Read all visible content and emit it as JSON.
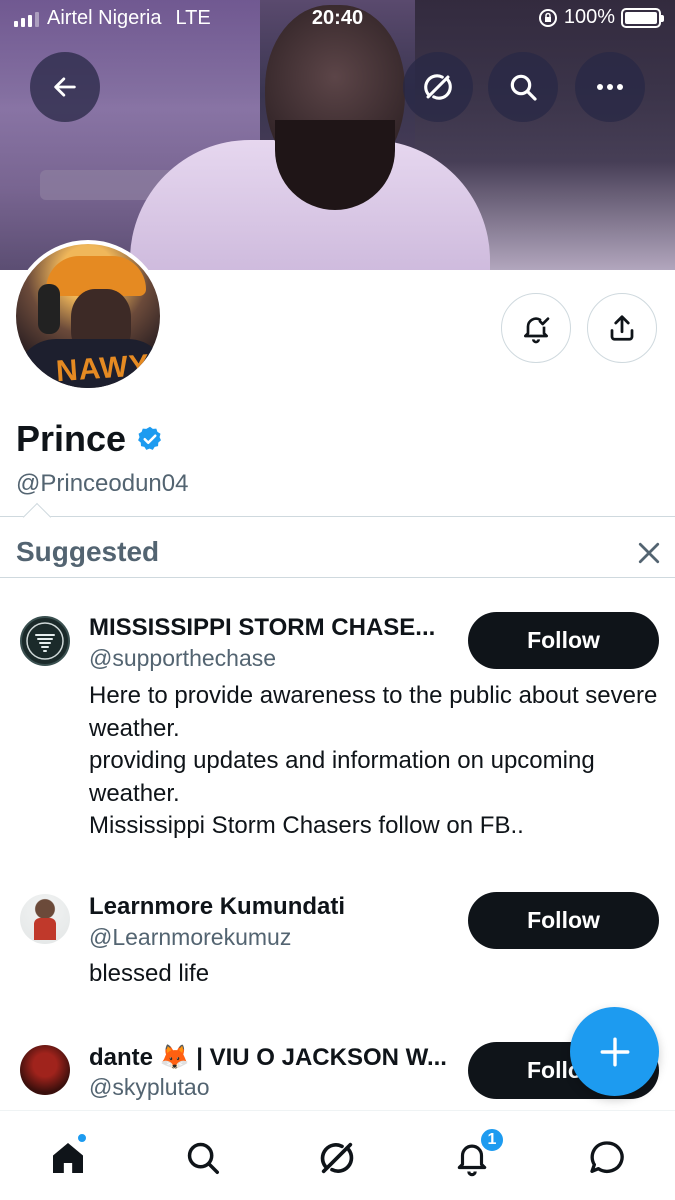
{
  "status_bar": {
    "carrier": "Airtel Nigeria",
    "network": "LTE",
    "time": "20:40",
    "battery": "100%"
  },
  "profile": {
    "name": "Prince",
    "handle": "@Princeodun04",
    "verified": true
  },
  "suggested": {
    "title": "Suggested",
    "items": [
      {
        "name": "MISSISSIPPI STORM CHASE...",
        "handle": "@supporthechase",
        "bio": "Here to provide awareness to the public about severe weather.\n providing updates and information on upcoming weather.\nMississippi Storm Chasers follow on FB..",
        "follow_label": "Follow"
      },
      {
        "name": "Learnmore Kumundati",
        "handle": "@Learnmorekumuz",
        "bio": "blessed life",
        "follow_label": "Follow"
      },
      {
        "name": "dante 🦊 | VIU O JACKSON W...",
        "handle": "@skyplutao",
        "bio": "",
        "follow_label": "Follo"
      }
    ]
  },
  "tabbar": {
    "notifications_badge": "1"
  },
  "colors": {
    "accent": "#1d9bf0",
    "text": "#0f1419",
    "secondary": "#536471"
  }
}
